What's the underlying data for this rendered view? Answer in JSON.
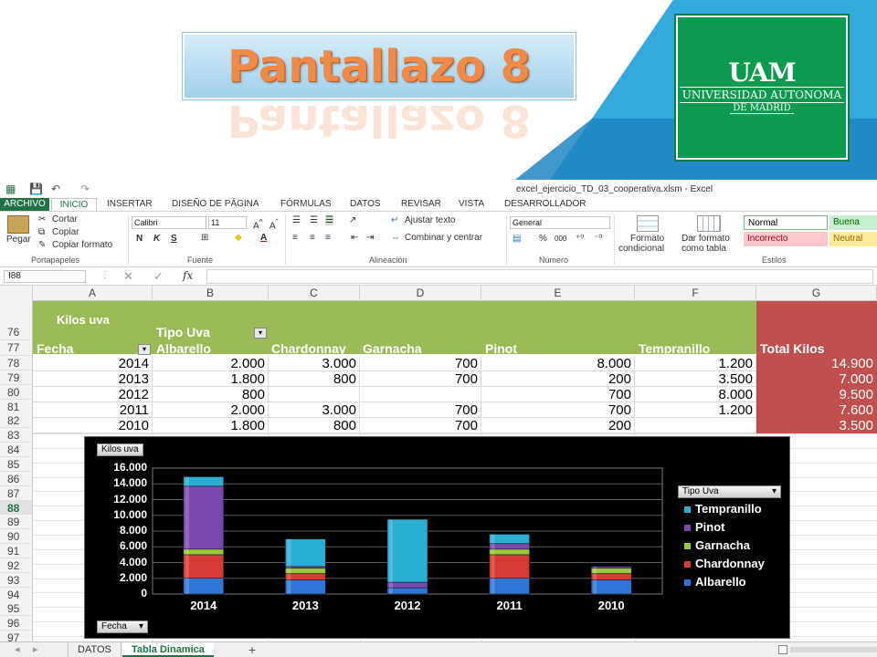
{
  "slide": {
    "title": "Pantallazo 8",
    "logo": {
      "acronym": "UAM",
      "line1": "UNIVERSIDAD AUTONOMA",
      "line2": "DE MADRID"
    }
  },
  "excel": {
    "window_title": "excel_ejercicio_TD_03_cooperativa.xlsm - Excel",
    "tabs": [
      "ARCHIVO",
      "INICIO",
      "INSERTAR",
      "DISEÑO DE PÁGINA",
      "FÓRMULAS",
      "DATOS",
      "REVISAR",
      "VISTA",
      "DESARROLLADOR"
    ],
    "ribbon": {
      "paste_label": "Pegar",
      "cut_label": "Cortar",
      "copy_label": "Copiar",
      "format_painter_label": "Copiar formato",
      "clipboard_group": "Portapapeles",
      "font_name": "Calibri",
      "font_size": "11",
      "bold": "N",
      "italic": "K",
      "underline": "S",
      "font_group": "Fuente",
      "wrap_text": "Ajustar texto",
      "merge_center": "Combinar y centrar",
      "alignment_group": "Alineación",
      "number_format": "General",
      "percent": "%",
      "thousands": "000",
      "number_group": "Número",
      "conditional_format_1": "Formato",
      "conditional_format_2": "condicional",
      "format_as_table_1": "Dar formato",
      "format_as_table_2": "como tabla",
      "styles": [
        "Normal",
        "Buena",
        "Incorrecto",
        "Neutral"
      ],
      "styles_group": "Estilos"
    },
    "name_box": "I88",
    "fx": "fx",
    "columns": [
      "A",
      "B",
      "C",
      "D",
      "E",
      "F",
      "G"
    ],
    "row_numbers": [
      "76",
      "77",
      "78",
      "79",
      "80",
      "81",
      "82",
      "83",
      "84",
      "85",
      "86",
      "87",
      "88",
      "89",
      "90",
      "91",
      "92",
      "93",
      "94",
      "95",
      "96",
      "97"
    ],
    "pivot": {
      "values_label": "Kilos uva",
      "column_field": "Tipo Uva",
      "row_field": "Fecha",
      "headers": [
        "Albarello",
        "Chardonnay",
        "Garnacha",
        "Pinot",
        "Tempranillo"
      ],
      "total_header": "Total Kilos",
      "rows": [
        {
          "fecha": "2014",
          "cells": [
            "2.000",
            "3.000",
            "700",
            "8.000",
            "1.200"
          ],
          "total": "14.900"
        },
        {
          "fecha": "2013",
          "cells": [
            "1.800",
            "800",
            "700",
            "200",
            "3.500"
          ],
          "total": "7.000"
        },
        {
          "fecha": "2012",
          "cells": [
            "800",
            "",
            "",
            "700",
            "8.000"
          ],
          "total": "9.500"
        },
        {
          "fecha": "2011",
          "cells": [
            "2.000",
            "3.000",
            "700",
            "700",
            "1.200"
          ],
          "total": "7.600"
        },
        {
          "fecha": "2010",
          "cells": [
            "1.800",
            "800",
            "700",
            "200",
            ""
          ],
          "total": "3.500"
        }
      ]
    },
    "sheet_tabs": [
      "DATOS",
      "Tabla Dinamica"
    ],
    "add_sheet": "+"
  },
  "chart_data": {
    "type": "bar",
    "stacked": true,
    "values_button": "Kilos uva",
    "axis_button": "Fecha",
    "legend_title": "Tipo Uva",
    "categories": [
      "2014",
      "2013",
      "2012",
      "2011",
      "2010"
    ],
    "series": [
      {
        "name": "Albarello",
        "values": [
          2000,
          1800,
          800,
          2000,
          1800
        ],
        "color": "#2e75d6"
      },
      {
        "name": "Chardonnay",
        "values": [
          3000,
          800,
          0,
          3000,
          800
        ],
        "color": "#d63a33"
      },
      {
        "name": "Garnacha",
        "values": [
          700,
          700,
          0,
          700,
          700
        ],
        "color": "#9bc83a"
      },
      {
        "name": "Pinot",
        "values": [
          8000,
          200,
          700,
          700,
          200
        ],
        "color": "#7a49b0"
      },
      {
        "name": "Tempranillo",
        "values": [
          1200,
          3500,
          8000,
          1200,
          0
        ],
        "color": "#2aaed2"
      }
    ],
    "legend_order": [
      "Tempranillo",
      "Pinot",
      "Garnacha",
      "Chardonnay",
      "Albarello"
    ],
    "yticks": [
      "0",
      "2.000",
      "4.000",
      "6.000",
      "8.000",
      "10.000",
      "12.000",
      "14.000",
      "16.000"
    ],
    "ylim": [
      0,
      16000
    ],
    "grid": true,
    "legend_position": "right"
  }
}
